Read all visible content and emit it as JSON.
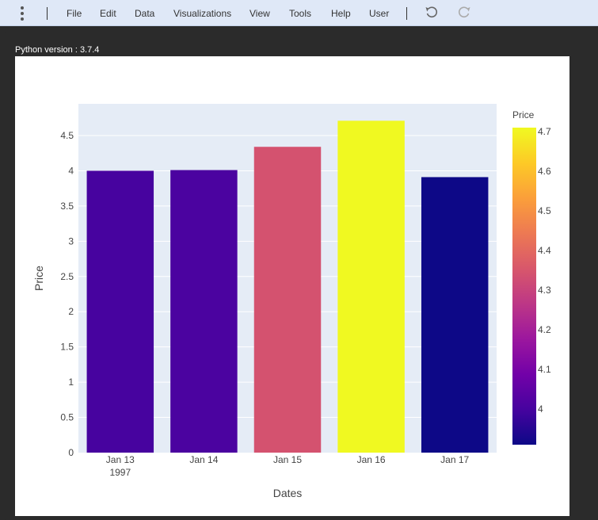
{
  "menu": {
    "items": [
      "File",
      "Edit",
      "Data",
      "Visualizations",
      "View",
      "Tools",
      "Help",
      "User"
    ],
    "kebab_icon": "kebab-menu-icon",
    "undo_icon": "undo-icon",
    "redo_icon": "redo-icon"
  },
  "output": {
    "label": "Python version :",
    "version": "3.7.4"
  },
  "chart_data": {
    "type": "bar",
    "categories": [
      "Jan 13",
      "Jan 14",
      "Jan 15",
      "Jan 16",
      "Jan 17"
    ],
    "x_tick_sublabel": "1997",
    "values": [
      4.0,
      4.01,
      4.34,
      4.71,
      3.91
    ],
    "xlabel": "Dates",
    "ylabel": "Price",
    "ylim": [
      0,
      4.95
    ],
    "yticks": [
      0,
      0.5,
      1,
      1.5,
      2,
      2.5,
      3,
      3.5,
      4,
      4.5
    ],
    "ytick_labels": [
      "0",
      "0.5",
      "1",
      "1.5",
      "2",
      "2.5",
      "3",
      "3.5",
      "4",
      "4.5"
    ],
    "grid": true,
    "plot_bg": "#e5ecf6",
    "colorscale": "plasma",
    "colorscale_stops": [
      "#0d0887",
      "#46039f",
      "#7201a8",
      "#9c179e",
      "#bd3786",
      "#d8576b",
      "#ed7953",
      "#fb9f3a",
      "#fdca26",
      "#f0f921"
    ],
    "colorbar": {
      "title": "Price",
      "range": [
        3.91,
        4.71
      ],
      "ticks": [
        4,
        4.1,
        4.2,
        4.3,
        4.4,
        4.5,
        4.6,
        4.7
      ],
      "tick_labels": [
        "4",
        "4.1",
        "4.2",
        "4.3",
        "4.4",
        "4.5",
        "4.6",
        "4.7"
      ]
    }
  }
}
